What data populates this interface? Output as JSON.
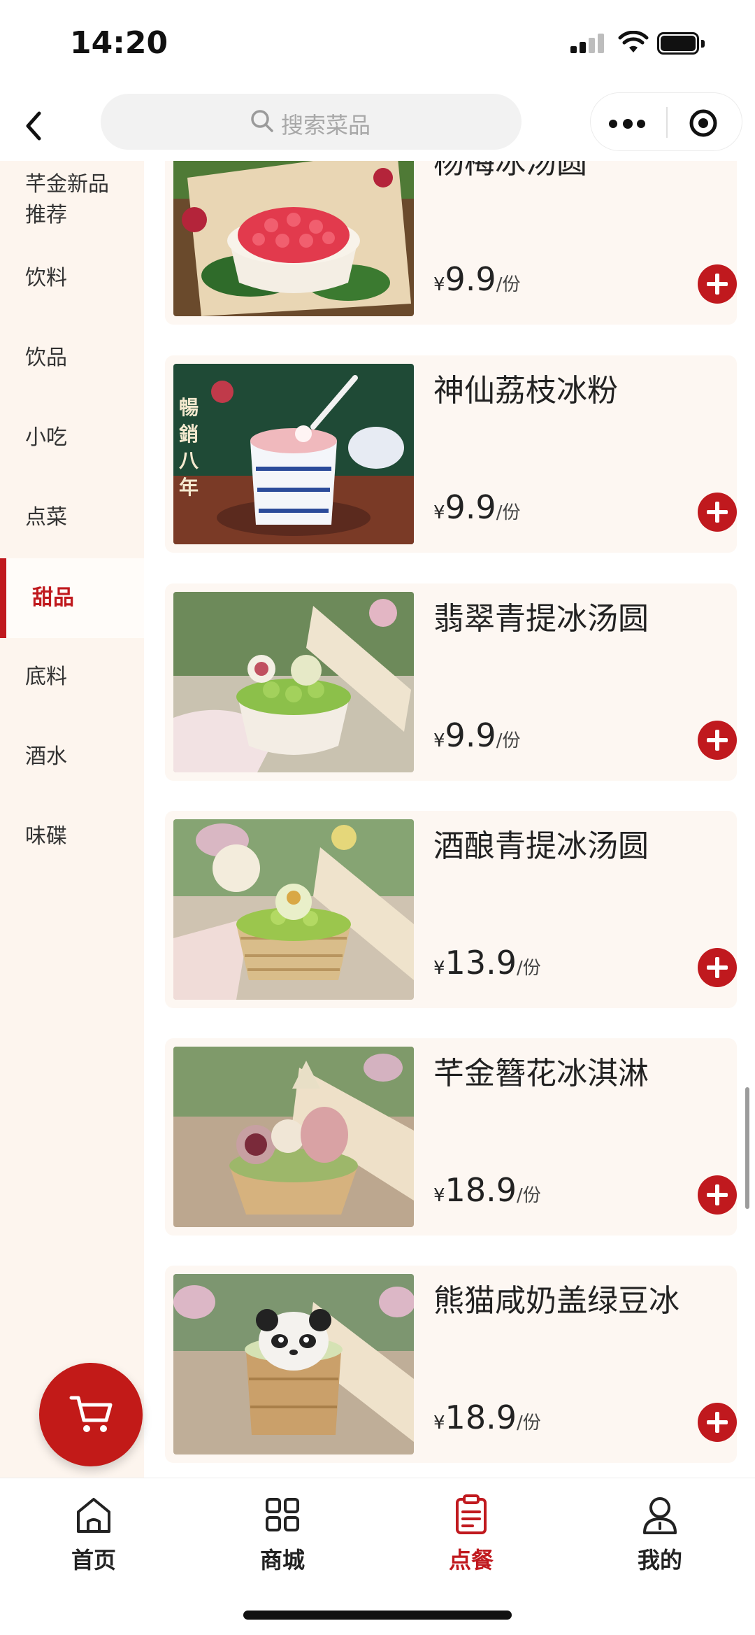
{
  "status": {
    "time": "14:20"
  },
  "search": {
    "placeholder": "搜索菜品"
  },
  "sidebar": {
    "items": [
      {
        "label": "芊金新品\n推荐"
      },
      {
        "label": "饮料"
      },
      {
        "label": "饮品"
      },
      {
        "label": "小吃"
      },
      {
        "label": "点菜"
      },
      {
        "label": "甜品",
        "active": true
      },
      {
        "label": "底料"
      },
      {
        "label": "酒水"
      },
      {
        "label": "味碟"
      }
    ]
  },
  "products": [
    {
      "name": "杨梅冰汤圆",
      "currency": "¥",
      "price": "9.9",
      "unit": "/份",
      "image": "bayberry-dessert"
    },
    {
      "name": "神仙荔枝冰粉",
      "currency": "¥",
      "price": "9.9",
      "unit": "/份",
      "image": "lychee-jelly-bowl",
      "image_text": "暢銷八年"
    },
    {
      "name": "翡翠青提冰汤圆",
      "currency": "¥",
      "price": "9.9",
      "unit": "/份",
      "image": "green-grape-dessert"
    },
    {
      "name": "酒酿青提冰汤圆",
      "currency": "¥",
      "price": "13.9",
      "unit": "/份",
      "image": "rice-wine-grape-dessert"
    },
    {
      "name": "芊金簪花冰淇淋",
      "currency": "¥",
      "price": "18.9",
      "unit": "/份",
      "image": "flower-ice-cream"
    },
    {
      "name": "熊猫咸奶盖绿豆冰",
      "currency": "¥",
      "price": "18.9",
      "unit": "/份",
      "image": "panda-mung-bean-ice"
    }
  ],
  "tabbar": {
    "items": [
      {
        "label": "首页",
        "icon": "home-icon"
      },
      {
        "label": "商城",
        "icon": "grid-icon"
      },
      {
        "label": "点餐",
        "icon": "order-icon",
        "active": true
      },
      {
        "label": "我的",
        "icon": "user-icon"
      }
    ]
  },
  "colors": {
    "accent": "#c0191e",
    "sidebar_bg": "#fdf5ee",
    "card_bg": "#fdf7f2"
  }
}
